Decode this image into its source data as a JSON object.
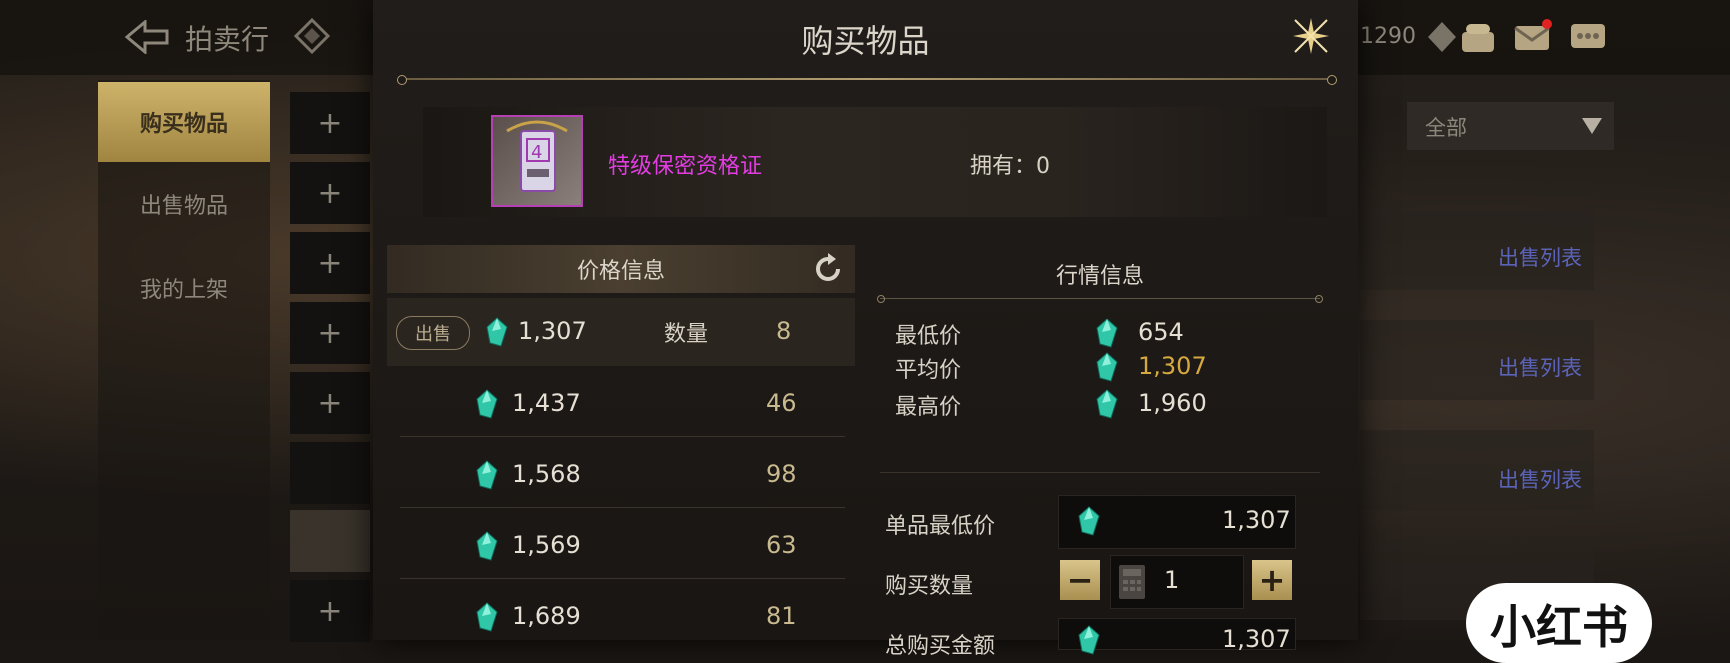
{
  "header": {
    "title": "拍卖行",
    "currency_amount": "1290"
  },
  "sidebar": {
    "items": [
      {
        "label": "购买物品",
        "active": true
      },
      {
        "label": "出售物品",
        "active": false
      },
      {
        "label": "我的上架",
        "active": false
      }
    ],
    "slot_symbol": "+"
  },
  "filter": {
    "selected": "全部"
  },
  "background_list": {
    "link_label": "出售列表"
  },
  "watermark": {
    "text": "小红书"
  },
  "modal": {
    "title": "购买物品",
    "item": {
      "name": "特级保密资格证",
      "owned_label": "拥有：0",
      "rarity_color": "#e23ce2"
    },
    "price_panel": {
      "title": "价格信息",
      "sell_tag": "出售",
      "quantity_label": "数量",
      "rows": [
        {
          "price": "1,307",
          "qty": "8"
        },
        {
          "price": "1,437",
          "qty": "46"
        },
        {
          "price": "1,568",
          "qty": "98"
        },
        {
          "price": "1,569",
          "qty": "63"
        },
        {
          "price": "1,689",
          "qty": "81"
        }
      ]
    },
    "market_panel": {
      "title": "行情信息",
      "min_label": "最低价",
      "min_value": "654",
      "avg_label": "平均价",
      "avg_value": "1,307",
      "max_label": "最高价",
      "max_value": "1,960"
    },
    "purchase_form": {
      "unit_price_label": "单品最低价",
      "unit_price_value": "1,307",
      "quantity_label": "购买数量",
      "quantity_value": "1",
      "minus_symbol": "−",
      "plus_symbol": "+",
      "total_label": "总购买金额",
      "total_value": "1,307"
    }
  },
  "colors": {
    "accent_gold": "#c9b06a",
    "gem_teal": "#2fc7a8",
    "avg_highlight": "#d6a940"
  }
}
